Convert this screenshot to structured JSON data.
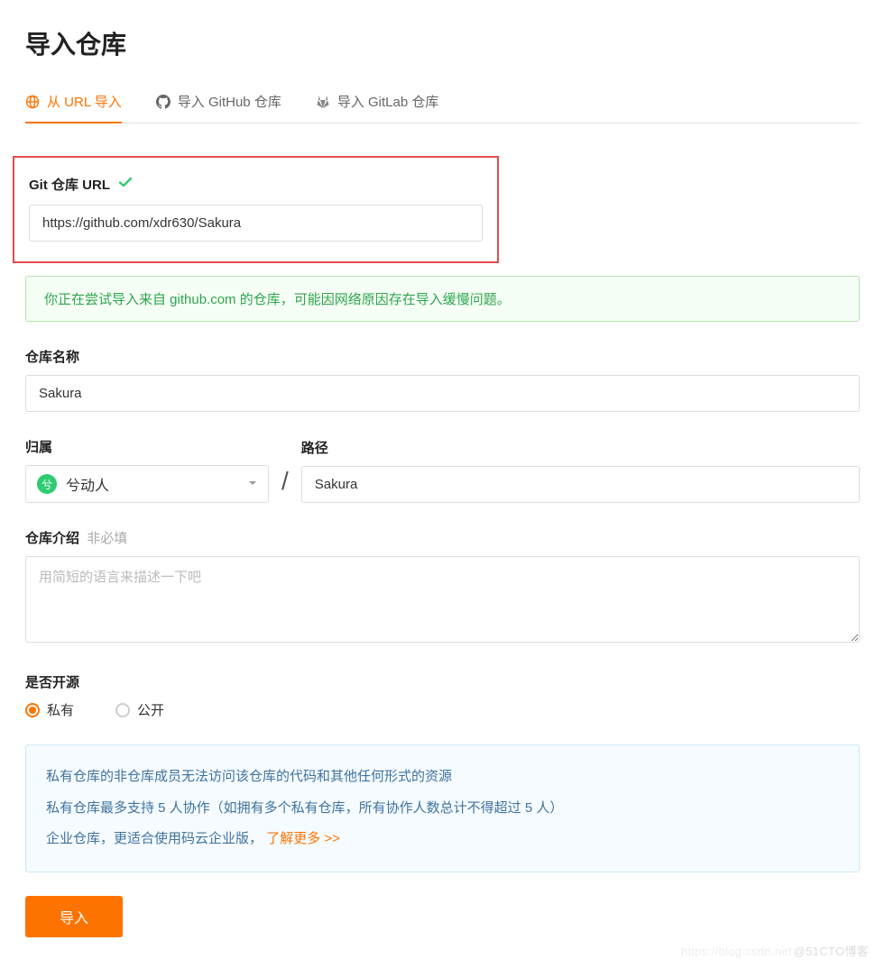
{
  "page": {
    "title": "导入仓库"
  },
  "tabs": [
    {
      "label": "从 URL 导入",
      "icon": "globe-icon",
      "active": true
    },
    {
      "label": "导入 GitHub 仓库",
      "icon": "github-icon",
      "active": false
    },
    {
      "label": "导入 GitLab 仓库",
      "icon": "gitlab-icon",
      "active": false
    }
  ],
  "git_url": {
    "label": "Git 仓库 URL",
    "value": "https://github.com/xdr630/Sakura",
    "valid": true
  },
  "alert": {
    "text": "你正在尝试导入来自 github.com 的仓库，可能因网络原因存在导入缓慢问题。"
  },
  "repo_name": {
    "label": "仓库名称",
    "value": "Sakura"
  },
  "owner": {
    "label": "归属",
    "avatar_char": "兮",
    "name": "兮动人"
  },
  "path": {
    "label": "路径",
    "value": "Sakura"
  },
  "description": {
    "label": "仓库介绍",
    "optional": "非必填",
    "placeholder": "用简短的语言来描述一下吧",
    "value": ""
  },
  "visibility": {
    "label": "是否开源",
    "options": [
      {
        "value": "private",
        "label": "私有",
        "checked": true
      },
      {
        "value": "public",
        "label": "公开",
        "checked": false
      }
    ]
  },
  "info_panel": {
    "lines": [
      "私有仓库的非仓库成员无法访问该仓库的代码和其他任何形式的资源",
      "私有仓库最多支持 5 人协作（如拥有多个私有仓库，所有协作人数总计不得超过 5 人）"
    ],
    "enterprise_prefix": "企业仓库，更适合使用码云企业版，",
    "enterprise_link": "了解更多 >>"
  },
  "submit": {
    "label": "导入"
  },
  "watermark": {
    "faint": "https://blog.csdn.net",
    "bold": "@51CTO博客"
  },
  "colors": {
    "accent": "#fe7300",
    "success": "#2ea44f",
    "info": "#40739e"
  }
}
